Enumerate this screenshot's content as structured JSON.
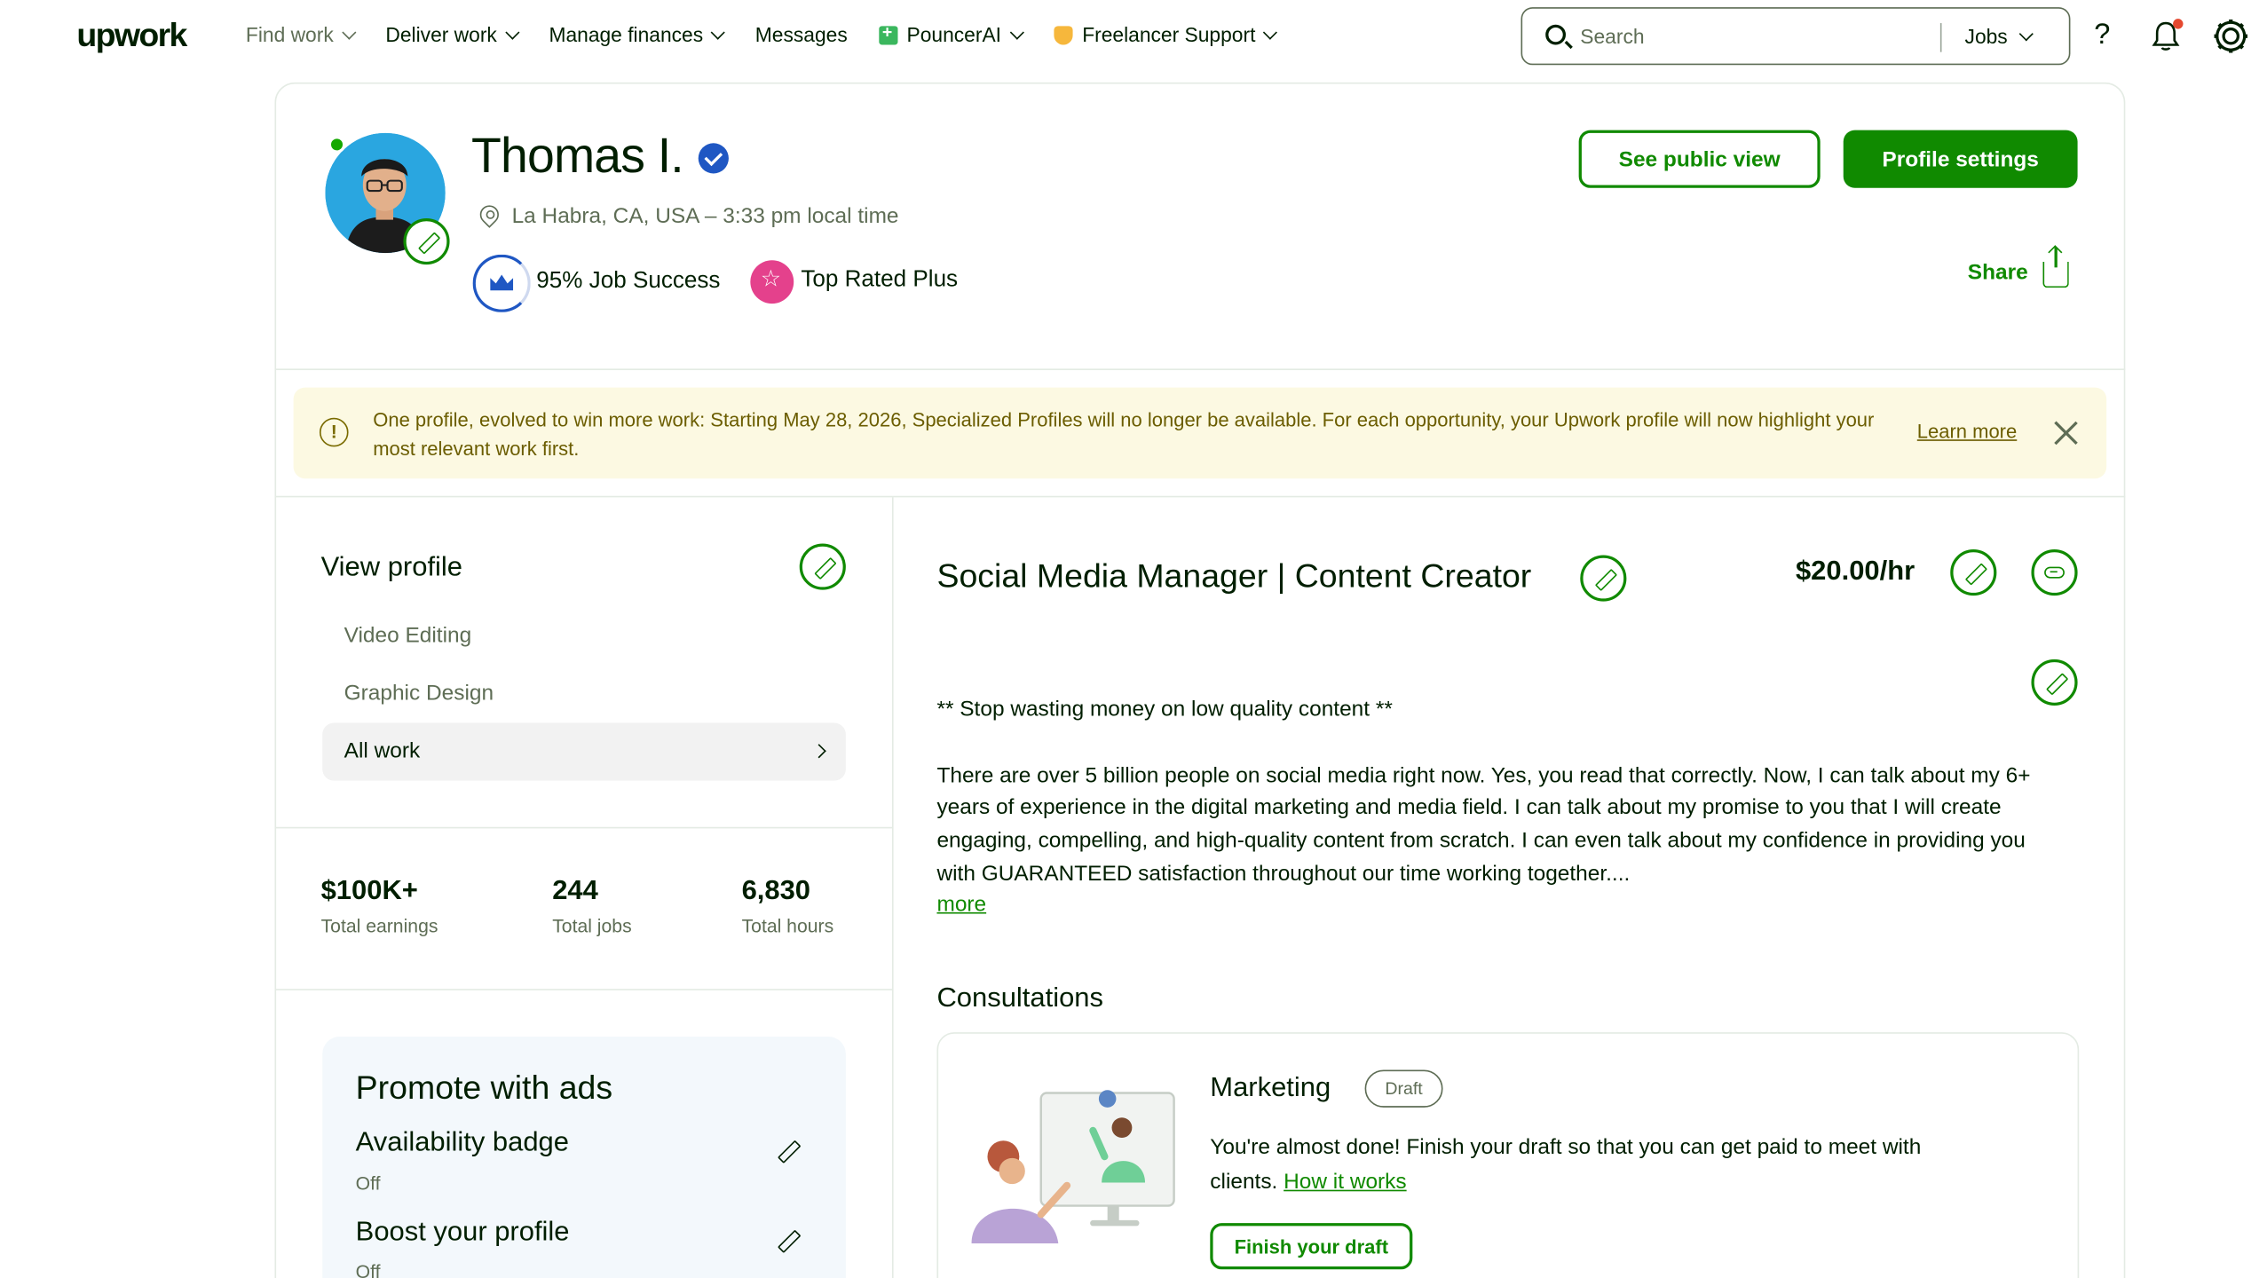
{
  "nav": {
    "logo": "upwork",
    "items": [
      {
        "label": "Find work",
        "has_dropdown": true,
        "muted": true
      },
      {
        "label": "Deliver work",
        "has_dropdown": true
      },
      {
        "label": "Manage finances",
        "has_dropdown": true
      },
      {
        "label": "Messages",
        "has_dropdown": false
      },
      {
        "label": "PouncerAI",
        "has_dropdown": true,
        "icon": "ai-badge-icon"
      },
      {
        "label": "Freelancer Support",
        "has_dropdown": true,
        "icon": "support-badge-icon"
      }
    ],
    "search_placeholder": "Search",
    "search_scope": "Jobs",
    "help_glyph": "?"
  },
  "profile": {
    "name": "Thomas I.",
    "location": "La Habra, CA, USA – 3:33 pm local time",
    "job_success": "95% Job Success",
    "badge": "Top Rated Plus",
    "see_public_view": "See public view",
    "profile_settings": "Profile settings",
    "share": "Share",
    "online": true
  },
  "banner": {
    "text": "One profile, evolved to win more work: Starting May 28, 2026, Specialized Profiles will no longer be available. For each opportunity, your Upwork profile will now highlight your most relevant work first.",
    "learn_more": "Learn more",
    "info_glyph": "!"
  },
  "sidebar": {
    "view_profile": "View profile",
    "specialties": [
      "Video Editing",
      "Graphic Design"
    ],
    "all_work": "All work",
    "stats": [
      {
        "value": "$100K+",
        "label": "Total earnings"
      },
      {
        "value": "244",
        "label": "Total jobs"
      },
      {
        "value": "6,830",
        "label": "Total hours"
      }
    ],
    "promo": {
      "title": "Promote with ads",
      "items": [
        {
          "label": "Availability badge",
          "status": "Off"
        },
        {
          "label": "Boost your profile",
          "status": "Off"
        }
      ]
    }
  },
  "main": {
    "title": "Social Media Manager | Content Creator",
    "rate": "$20.00/hr",
    "overview_heading": "** Stop wasting money on low quality content **",
    "overview_body": "There are over 5 billion people on social media right now. Yes, you read that correctly. Now, I can talk about my 6+ years of experience in the digital marketing and media field. I can talk about my promise to you that I will create engaging, compelling, and high-quality content from scratch. I can even talk about my confidence in providing you with GUARANTEED satisfaction throughout our time working together....",
    "more": "more",
    "consultations": {
      "title": "Consultations",
      "card": {
        "name": "Marketing",
        "status": "Draft",
        "text": "You're almost done! Finish your draft so that you can get paid to meet with clients.",
        "link": "How it works",
        "button": "Finish your draft"
      }
    }
  },
  "colors": {
    "brand_green": "#108a00",
    "text": "#001e00",
    "muted": "#5e6d55",
    "banner_bg": "#fcf9e2",
    "verified_blue": "#1f57c3",
    "top_rated_pink": "#e4418c"
  }
}
